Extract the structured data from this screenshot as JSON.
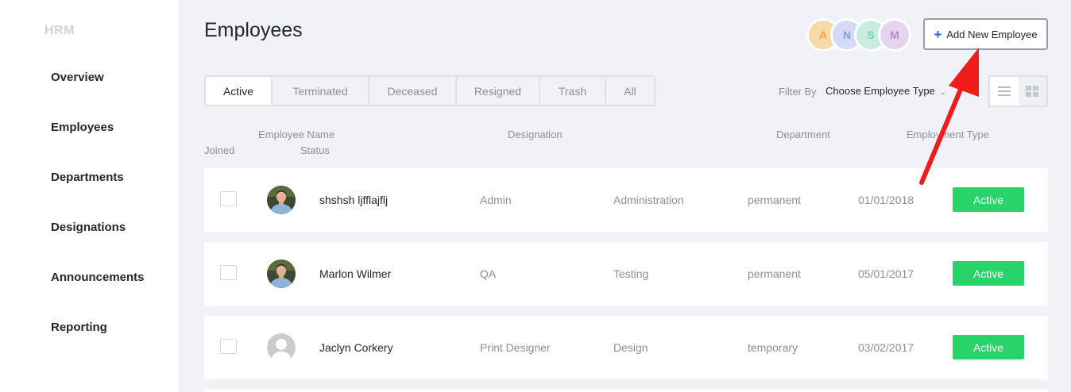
{
  "sidebar": {
    "brand": "HRM",
    "items": [
      {
        "label": "Overview"
      },
      {
        "label": "Employees"
      },
      {
        "label": "Departments"
      },
      {
        "label": "Designations"
      },
      {
        "label": "Announcements"
      },
      {
        "label": "Reporting"
      }
    ]
  },
  "header": {
    "title": "Employees",
    "avatars": [
      {
        "letter": "A",
        "bg": "#f7d9a8",
        "fg": "#e8a83c"
      },
      {
        "letter": "N",
        "bg": "#d4d9f7",
        "fg": "#8f9ae0"
      },
      {
        "letter": "S",
        "bg": "#c6ede0",
        "fg": "#79d0b2"
      },
      {
        "letter": "M",
        "bg": "#e6d4ee",
        "fg": "#b58bc9"
      }
    ],
    "add_button": "Add New Employee",
    "add_icon": "plus-icon"
  },
  "tabs": [
    {
      "label": "Active",
      "active": true
    },
    {
      "label": "Terminated"
    },
    {
      "label": "Deceased"
    },
    {
      "label": "Resigned"
    },
    {
      "label": "Trash"
    },
    {
      "label": "All"
    }
  ],
  "filter": {
    "label": "Filter By",
    "value": "Choose Employee Type"
  },
  "table": {
    "headers": {
      "employee_name": "Employee Name",
      "designation": "Designation",
      "department": "Department",
      "employment_type": "Employment Type",
      "joined": "Joined",
      "status": "Status"
    },
    "rows": [
      {
        "name": "shshsh ljfflajflj",
        "designation": "Admin",
        "department": "Administration",
        "type": "permanent",
        "joined": "01/01/2018",
        "status": "Active",
        "avatar": "photo"
      },
      {
        "name": "Marlon Wilmer",
        "designation": "QA",
        "department": "Testing",
        "type": "permanent",
        "joined": "05/01/2017",
        "status": "Active",
        "avatar": "photo"
      },
      {
        "name": "Jaclyn Corkery",
        "designation": "Print Designer",
        "department": "Design",
        "type": "temporary",
        "joined": "03/02/2017",
        "status": "Active",
        "avatar": "placeholder"
      }
    ]
  },
  "colors": {
    "status_active": "#28d36a",
    "annotation_arrow": "#f01b1b",
    "add_icon": "#2d5fc7"
  }
}
